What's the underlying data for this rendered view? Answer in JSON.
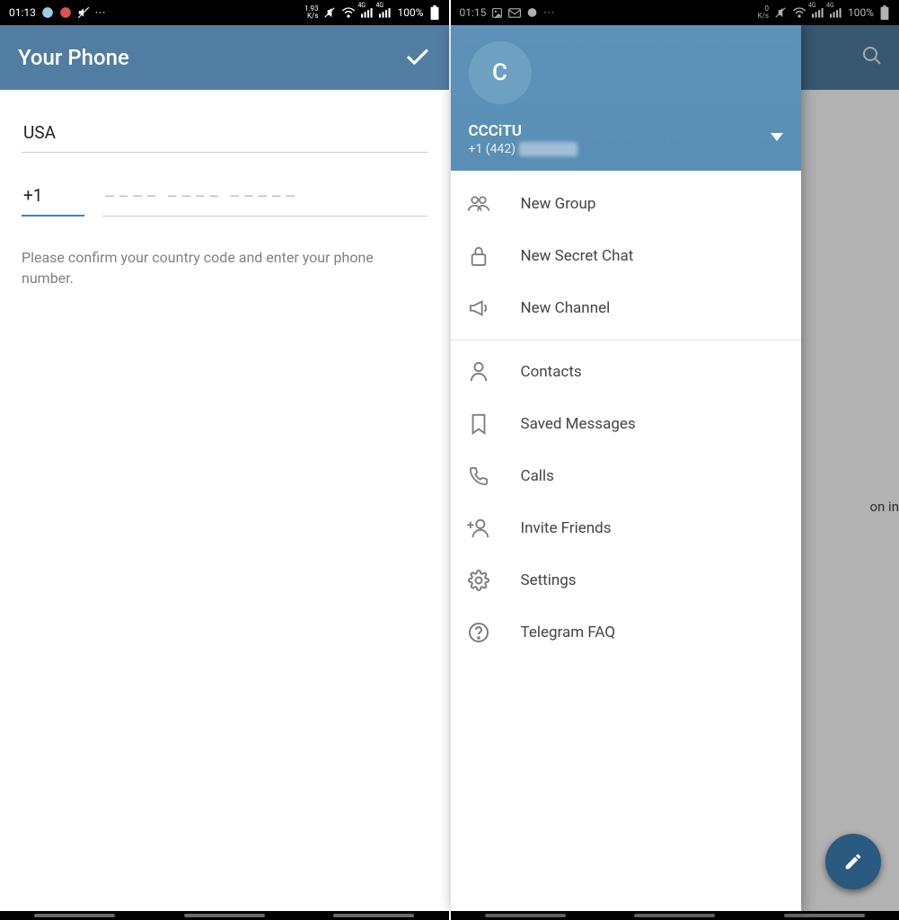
{
  "left": {
    "status": {
      "time": "01:13",
      "speed_top": "1.93",
      "speed_unit": "K/s",
      "net_label": "4G",
      "battery": "100%",
      "dots": "···"
    },
    "toolbar": {
      "title": "Your Phone"
    },
    "entry": {
      "country": "USA",
      "code": "+1",
      "placeholder": "––––  ––––  –––––",
      "hint": "Please confirm your country code and enter your phone number."
    }
  },
  "right": {
    "status": {
      "time": "01:15",
      "speed_top": "0",
      "speed_unit": "K/s",
      "net_label": "4G",
      "battery": "100%",
      "dots": "···"
    },
    "bg_text": "on in",
    "drawer": {
      "avatar_letter": "C",
      "name": "CCCiTU",
      "phone_prefix": "+1 (442)",
      "menu_a": [
        {
          "id": "new-group",
          "label": "New Group"
        },
        {
          "id": "new-secret-chat",
          "label": "New Secret Chat"
        },
        {
          "id": "new-channel",
          "label": "New Channel"
        }
      ],
      "menu_b": [
        {
          "id": "contacts",
          "label": "Contacts"
        },
        {
          "id": "saved-messages",
          "label": "Saved Messages"
        },
        {
          "id": "calls",
          "label": "Calls"
        },
        {
          "id": "invite-friends",
          "label": "Invite Friends"
        },
        {
          "id": "settings",
          "label": "Settings"
        },
        {
          "id": "telegram-faq",
          "label": "Telegram FAQ"
        }
      ]
    }
  }
}
